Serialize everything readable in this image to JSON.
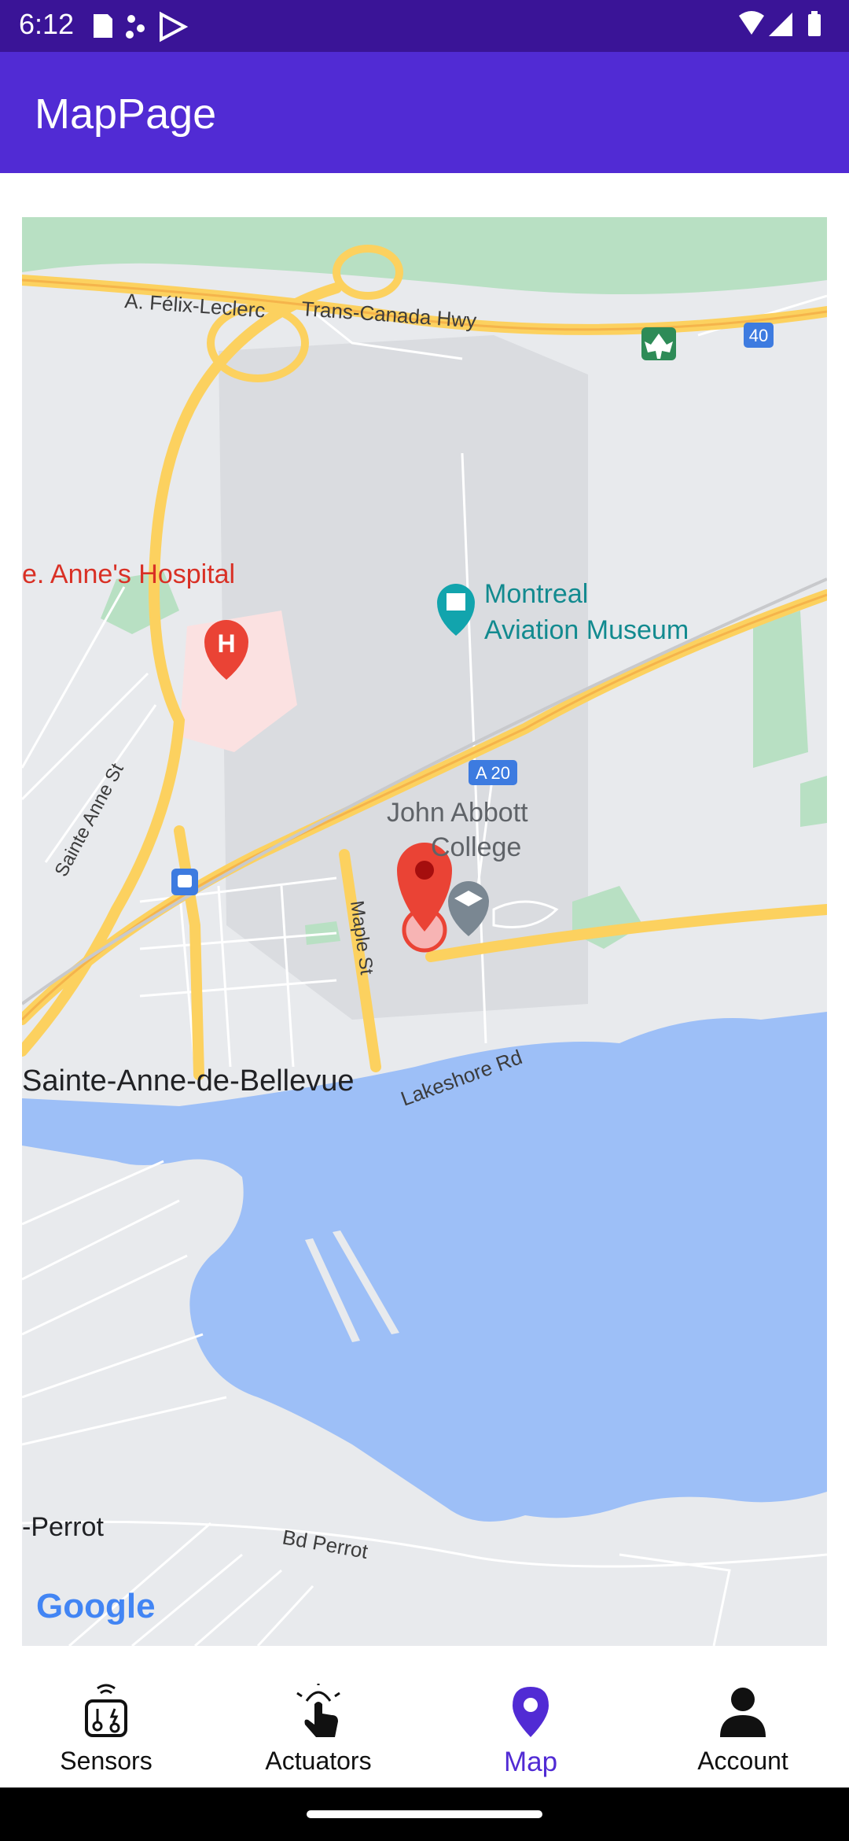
{
  "status_bar": {
    "time": "6:12"
  },
  "app_bar": {
    "title": "MapPage"
  },
  "map": {
    "labels": {
      "highway": "A. Félix-Leclerc",
      "trans_canada": "Trans-Canada Hwy",
      "route_40": "40",
      "hospital": "e. Anne's Hospital",
      "museum_line1": "Montreal",
      "museum_line2": "Aviation Museum",
      "a20": "A 20",
      "college_line1": "John Abbott",
      "college_line2": "College",
      "sainte_anne_st": "Sainte Anne St",
      "maple_st": "Maple St",
      "town": "Sainte-Anne-de-Bellevue",
      "lakeshore": "Lakeshore Rd",
      "perrot_town": "-Perrot",
      "bd_perrot": "Bd Perrot",
      "google": "Google"
    },
    "colors": {
      "land": "#e8eaed",
      "water": "#9dbff7",
      "park": "#b8e0c3",
      "highway": "#fcd15f",
      "pin": "#ea4335",
      "museum_text": "#128a8f",
      "hospital_text": "#d93025"
    }
  },
  "bottom_nav": {
    "items": [
      {
        "label": "Sensors",
        "icon": "sensors-icon"
      },
      {
        "label": "Actuators",
        "icon": "touch-icon"
      },
      {
        "label": "Map",
        "icon": "map-pin-icon",
        "active": true
      },
      {
        "label": "Account",
        "icon": "person-icon"
      }
    ],
    "active_color": "#512bd4"
  }
}
